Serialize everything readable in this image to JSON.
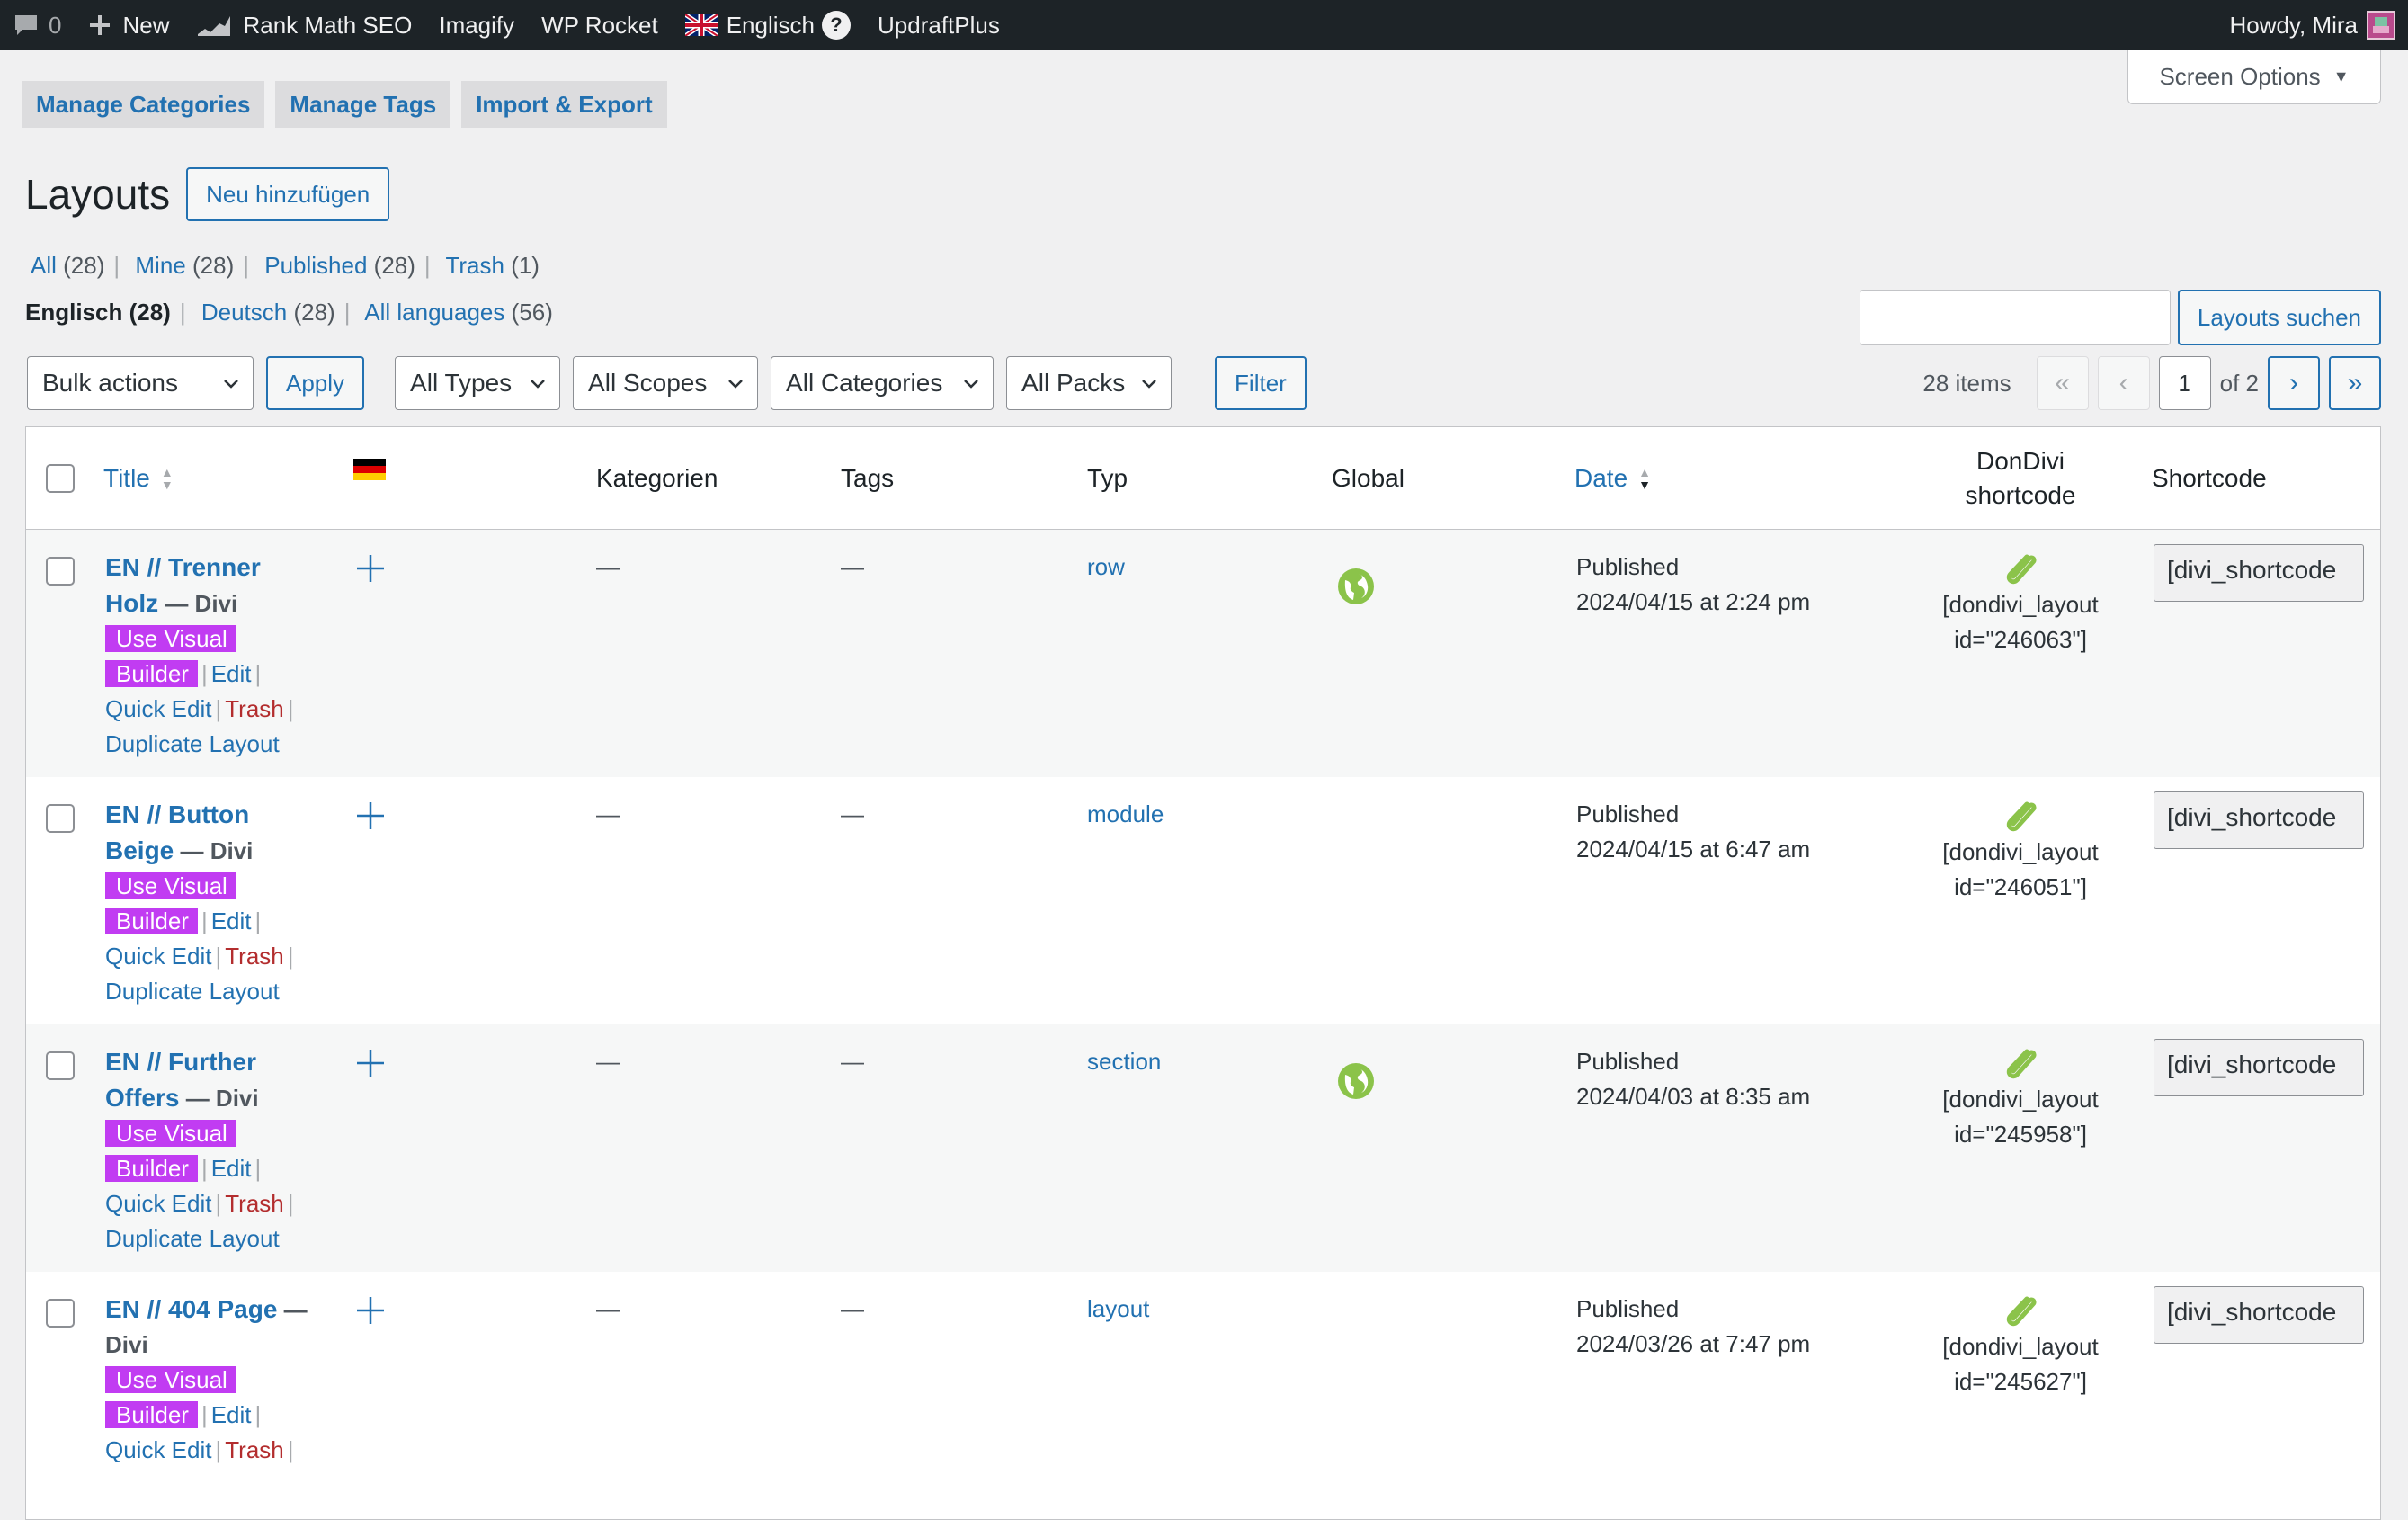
{
  "adminbar": {
    "comments_count": "0",
    "new_label": "New",
    "rank_math": "Rank Math SEO",
    "imagify": "Imagify",
    "wp_rocket": "WP Rocket",
    "language": "Englisch",
    "help": "?",
    "updraft": "UpdraftPlus",
    "howdy": "Howdy, Mira"
  },
  "screen_options": "Screen Options",
  "subnav": [
    "Manage Categories",
    "Manage Tags",
    "Import & Export"
  ],
  "page_title": "Layouts",
  "add_new": "Neu hinzufügen",
  "views": [
    {
      "label": "All",
      "count": "(28)"
    },
    {
      "label": "Mine",
      "count": "(28)"
    },
    {
      "label": "Published",
      "count": "(28)"
    },
    {
      "label": "Trash",
      "count": "(1)"
    }
  ],
  "languages": [
    {
      "label": "Englisch",
      "count": "(28)"
    },
    {
      "label": "Deutsch",
      "count": "(28)"
    },
    {
      "label": "All languages",
      "count": "(56)"
    }
  ],
  "search": {
    "button": "Layouts suchen",
    "value": ""
  },
  "filters": {
    "bulk": "Bulk actions",
    "apply": "Apply",
    "types": "All Types",
    "scopes": "All Scopes",
    "categories": "All Categories",
    "packs": "All Packs",
    "filter": "Filter"
  },
  "pagination": {
    "items": "28 items",
    "first": "«",
    "prev": "‹",
    "current": "1",
    "of": "of 2",
    "next": "›",
    "last": "»"
  },
  "columns": {
    "title": "Title",
    "kategorien": "Kategorien",
    "tags": "Tags",
    "typ": "Typ",
    "global": "Global",
    "date": "Date",
    "dondivi_1": "DonDivi",
    "dondivi_2": "shortcode",
    "shortcode": "Shortcode"
  },
  "row_actions": {
    "vb1": "Use Visual",
    "vb2": "Builder",
    "edit": "Edit",
    "quick_edit": "Quick Edit",
    "trash": "Trash",
    "duplicate": "Duplicate Layout"
  },
  "rows": [
    {
      "title1": "EN // Trenner",
      "title2": "Holz",
      "state": " — Divi",
      "kategorien": "—",
      "tags": "—",
      "typ": "row",
      "global": true,
      "status": "Published",
      "date": "2024/04/15 at 2:24 pm",
      "dd1": "[dondivi_layout",
      "dd2": "id=\"246063\"]",
      "shortcode": "[divi_shortcode"
    },
    {
      "title1": "EN // Button",
      "title2": "Beige",
      "state": " — Divi",
      "kategorien": "—",
      "tags": "—",
      "typ": "module",
      "global": false,
      "status": "Published",
      "date": "2024/04/15 at 6:47 am",
      "dd1": "[dondivi_layout",
      "dd2": "id=\"246051\"]",
      "shortcode": "[divi_shortcode"
    },
    {
      "title1": "EN // Further",
      "title2": "Offers",
      "state": " — Divi",
      "kategorien": "—",
      "tags": "—",
      "typ": "section",
      "global": true,
      "status": "Published",
      "date": "2024/04/03 at 8:35 am",
      "dd1": "[dondivi_layout",
      "dd2": "id=\"245958\"]",
      "shortcode": "[divi_shortcode"
    },
    {
      "title1": "EN // 404 Page",
      "title2": "",
      "state": " — Divi",
      "kategorien": "—",
      "tags": "—",
      "typ": "layout",
      "global": false,
      "status": "Published",
      "date": "2024/03/26 at 7:47 pm",
      "dd1": "[dondivi_layout",
      "dd2": "id=\"245627\"]",
      "shortcode": "[divi_shortcode"
    }
  ],
  "colors": {
    "accent": "#2271b1",
    "visual_builder": "#c13cf2",
    "trash": "#b32d2e",
    "global_icon": "#8bc34a"
  }
}
